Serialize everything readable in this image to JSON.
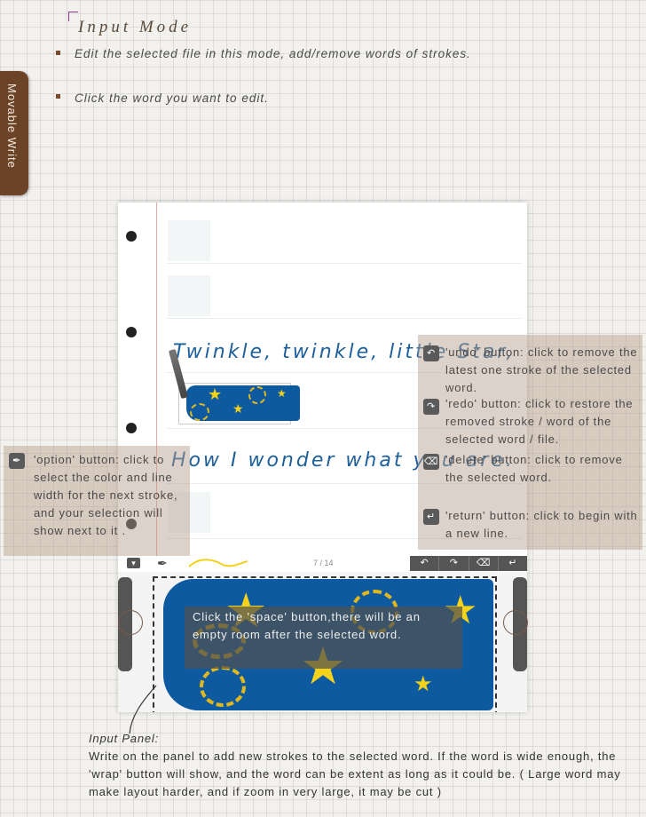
{
  "header": {
    "title": "Input Mode"
  },
  "bullets": [
    "Edit the selected file in this mode, add/remove words of strokes.",
    "Click the word you want to edit."
  ],
  "side_tab": {
    "label": "Movable Write"
  },
  "notebook": {
    "line1": "Twinkle, twinkle, little Star,",
    "line2": "How I wonder what you are.",
    "page_indicator": "7 / 14"
  },
  "toolbar": {
    "icons": [
      "collapse-icon",
      "feather-icon",
      "undo-icon",
      "redo-icon",
      "delete-icon",
      "return-icon"
    ]
  },
  "callouts": {
    "option": "'option' button: click to select the color and line width for the next stroke, and your selection will show next to it .",
    "undo": "'undo' button: click to remove the latest one stroke of the selected word.",
    "redo": "'redo' button: click to restore the removed stroke / word of the selected word / file.",
    "delete": "'delete' button: click to remove the selected word.",
    "return": "'return' button: click to begin with a new line.",
    "space": "Click the 'space' button,there will be an empty room after the selected word."
  },
  "input_panel": {
    "label": "Input Panel:",
    "text": "Write on the panel to add new strokes to the selected word. If the word is wide enough, the 'wrap' button will show, and the word can be extent as long as it could be. ( Large word may make layout harder, and if zoom in very large, it may be cut )"
  },
  "colors": {
    "accent": "#6b4428",
    "ink": "#1d5f9a",
    "paint_blue": "#0d5aa1",
    "star_yellow": "#f4d21a"
  }
}
